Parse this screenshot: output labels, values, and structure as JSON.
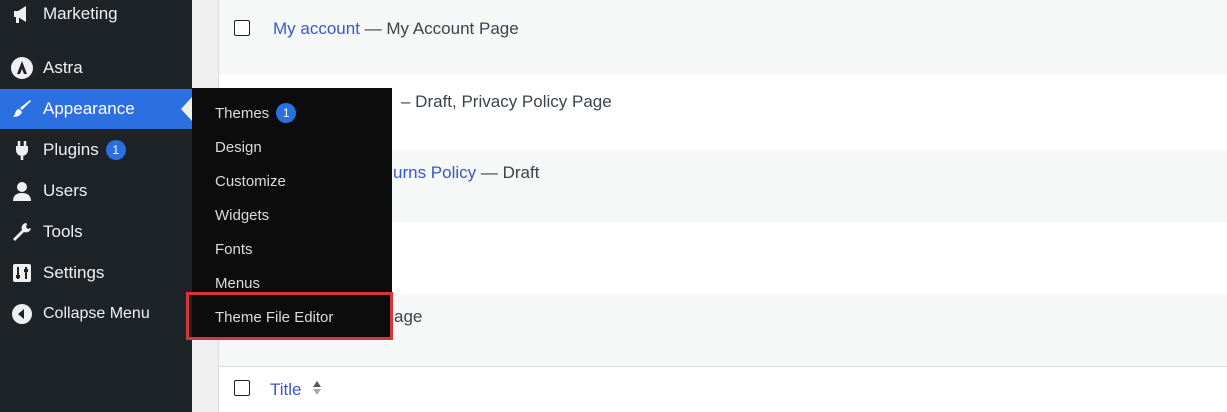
{
  "sidebar": {
    "items": [
      {
        "label": "Marketing",
        "icon": "megaphone-icon"
      },
      {
        "label": "Astra",
        "icon": "astra-icon"
      },
      {
        "label": "Appearance",
        "icon": "paintbrush-icon",
        "active": true
      },
      {
        "label": "Plugins",
        "icon": "plug-icon",
        "badge": "1"
      },
      {
        "label": "Users",
        "icon": "user-icon"
      },
      {
        "label": "Tools",
        "icon": "wrench-icon"
      },
      {
        "label": "Settings",
        "icon": "sliders-icon"
      },
      {
        "label": "Collapse Menu",
        "icon": "collapse-arrow-icon"
      }
    ]
  },
  "appearance_submenu": {
    "items": [
      {
        "label": "Themes",
        "badge": "1"
      },
      {
        "label": "Design"
      },
      {
        "label": "Customize"
      },
      {
        "label": "Widgets"
      },
      {
        "label": "Fonts"
      },
      {
        "label": "Menus"
      },
      {
        "label": "Theme File Editor",
        "highlighted": true
      }
    ]
  },
  "pages_table": {
    "rows": [
      {
        "link": "My account",
        "suffix": " — My Account Page"
      },
      {
        "link": "",
        "suffix": "– Draft, Privacy Policy Page"
      },
      {
        "link": "urns Policy",
        "suffix": " — Draft"
      },
      {
        "link": "",
        "suffix": ""
      },
      {
        "link": "",
        "suffix": "age"
      }
    ],
    "footer": {
      "column_title": "Title"
    }
  },
  "colors": {
    "sidebar_bg": "#1d2327",
    "active_bg": "#2c6fe0",
    "flyout_bg": "#0c0c0c",
    "highlight_border": "#d63638",
    "link": "#3858c9"
  }
}
